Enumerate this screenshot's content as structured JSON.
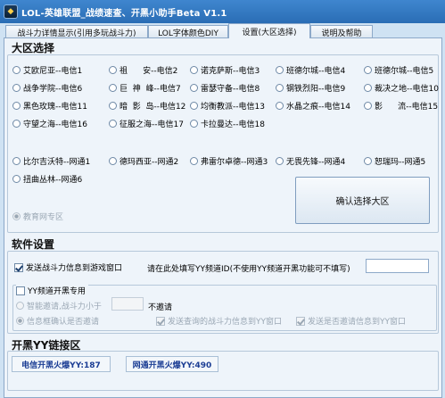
{
  "window": {
    "title": "LOL-英雄联盟_战绩速查、开黑小助手Beta V1.1",
    "icon": "lol-app-icon"
  },
  "tabs": [
    {
      "label": "战斗力详情显示(引用多玩战斗力)"
    },
    {
      "label": "LOL字体颜色DIY"
    },
    {
      "label": "设置(大区选择)"
    },
    {
      "label": "说明及帮助"
    }
  ],
  "region": {
    "title": "大区选择",
    "servers": [
      {
        "label": "艾欧尼亚--电信1",
        "checked": false,
        "disabled": false
      },
      {
        "label": "祖      安--电信2",
        "checked": false,
        "disabled": false
      },
      {
        "label": "诺克萨斯--电信3",
        "checked": false,
        "disabled": false
      },
      {
        "label": "班德尔城--电信4",
        "checked": false,
        "disabled": false
      },
      {
        "label": "班德尔城--电信5",
        "checked": false,
        "disabled": false
      },
      {
        "label": "战争学院--电信6",
        "checked": false,
        "disabled": false
      },
      {
        "label": "巨  神  峰--电信7",
        "checked": false,
        "disabled": false
      },
      {
        "label": "雷瑟守备--电信8",
        "checked": false,
        "disabled": false
      },
      {
        "label": "钢铁烈阳--电信9",
        "checked": false,
        "disabled": false
      },
      {
        "label": "裁决之地--电信10",
        "checked": false,
        "disabled": false
      },
      {
        "label": "黑色玫瑰--电信11",
        "checked": false,
        "disabled": false
      },
      {
        "label": "暗  影  岛--电信12",
        "checked": false,
        "disabled": false
      },
      {
        "label": "均衡教派--电信13",
        "checked": false,
        "disabled": false
      },
      {
        "label": "水晶之痕--电信14",
        "checked": false,
        "disabled": false
      },
      {
        "label": "影      流--电信15",
        "checked": false,
        "disabled": false
      },
      {
        "label": "守望之海--电信16",
        "checked": false,
        "disabled": false
      },
      {
        "label": "征服之海--电信17",
        "checked": false,
        "disabled": false
      },
      {
        "label": "卡拉曼达--电信18",
        "checked": false,
        "disabled": false
      },
      {
        "label": "比尔吉沃特--网通1",
        "checked": false,
        "disabled": false
      },
      {
        "label": "德玛西亚--网通2",
        "checked": false,
        "disabled": false
      },
      {
        "label": "弗雷尔卓德--网通3",
        "checked": false,
        "disabled": false
      },
      {
        "label": "无畏先锋--网通4",
        "checked": false,
        "disabled": false
      },
      {
        "label": "恕瑞玛--网通5",
        "checked": false,
        "disabled": false
      },
      {
        "label": "扭曲丛林--网通6",
        "checked": false,
        "disabled": false
      },
      {
        "label": "教育网专区",
        "checked": true,
        "disabled": true
      }
    ],
    "confirm_button": "确认选择大区"
  },
  "software": {
    "title": "软件设置",
    "send_stats": {
      "label": "发送战斗力信息到游戏窗口",
      "checked": true
    },
    "yy_prompt": "请在此处填写YY频道ID(不使用YY频道开黑功能可不填写)",
    "yy_channel_value": "",
    "yy_dedicated": {
      "label": "YY频道开黑专用",
      "checked": false
    },
    "smart_invite": {
      "label": "智能邀请,战斗力小于",
      "checked": false,
      "disabled": true
    },
    "threshold_value": "",
    "no_invite_label": "不邀请",
    "popup_confirm": {
      "label": "信息框确认是否邀请",
      "checked": true,
      "disabled": true
    },
    "send_query": {
      "label": "发送查询的战斗力信息到YY窗口",
      "checked": true,
      "disabled": true
    },
    "send_invite_info": {
      "label": "发送是否邀请信息到YY窗口",
      "checked": true,
      "disabled": true
    }
  },
  "links": {
    "title": "开黑YY链接区",
    "telecom": "电信开黑火爆YY:187",
    "netcom": "网通开黑火爆YY:490"
  },
  "colors": {
    "titlebar": "#2a6db5",
    "panel": "#eef4fa",
    "link_text": "#1b3d94"
  }
}
